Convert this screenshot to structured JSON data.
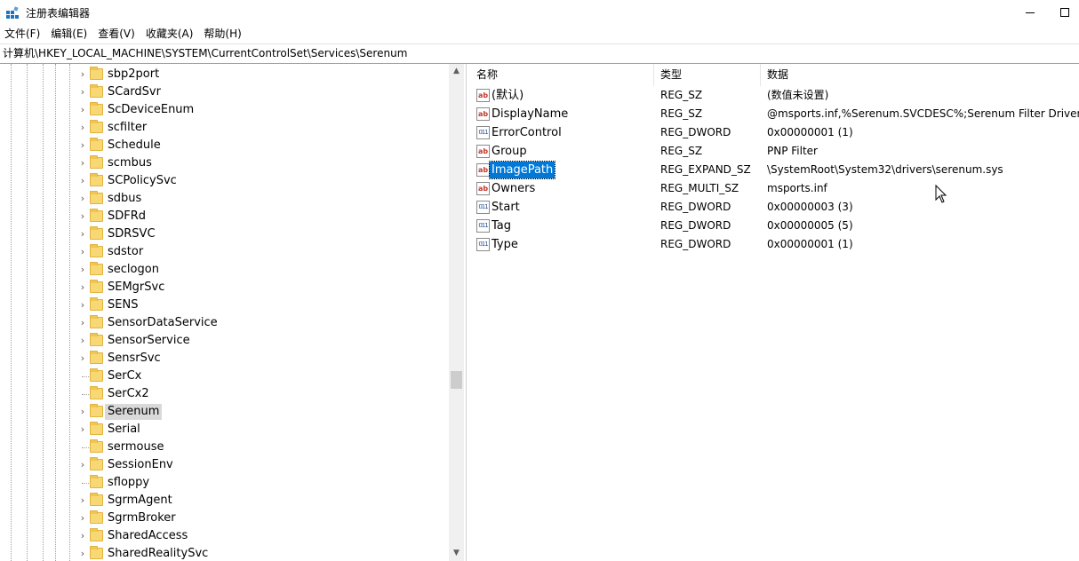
{
  "window": {
    "title": "注册表编辑器",
    "minimize_icon": "minimize-icon",
    "maximize_icon": "maximize-icon"
  },
  "menu": [
    "文件(F)",
    "编辑(E)",
    "查看(V)",
    "收藏夹(A)",
    "帮助(H)"
  ],
  "address": "计算机\\HKEY_LOCAL_MACHINE\\SYSTEM\\CurrentControlSet\\Services\\Serenum",
  "tree": {
    "items": [
      {
        "label": "sbp2port",
        "expandable": true
      },
      {
        "label": "SCardSvr",
        "expandable": true
      },
      {
        "label": "ScDeviceEnum",
        "expandable": true
      },
      {
        "label": "scfilter",
        "expandable": true
      },
      {
        "label": "Schedule",
        "expandable": true
      },
      {
        "label": "scmbus",
        "expandable": true
      },
      {
        "label": "SCPolicySvc",
        "expandable": true
      },
      {
        "label": "sdbus",
        "expandable": true
      },
      {
        "label": "SDFRd",
        "expandable": true
      },
      {
        "label": "SDRSVC",
        "expandable": true
      },
      {
        "label": "sdstor",
        "expandable": true
      },
      {
        "label": "seclogon",
        "expandable": true
      },
      {
        "label": "SEMgrSvc",
        "expandable": true
      },
      {
        "label": "SENS",
        "expandable": true
      },
      {
        "label": "SensorDataService",
        "expandable": true
      },
      {
        "label": "SensorService",
        "expandable": true
      },
      {
        "label": "SensrSvc",
        "expandable": true
      },
      {
        "label": "SerCx",
        "expandable": false
      },
      {
        "label": "SerCx2",
        "expandable": false
      },
      {
        "label": "Serenum",
        "expandable": true,
        "selected": true
      },
      {
        "label": "Serial",
        "expandable": true
      },
      {
        "label": "sermouse",
        "expandable": false
      },
      {
        "label": "SessionEnv",
        "expandable": true
      },
      {
        "label": "sfloppy",
        "expandable": false
      },
      {
        "label": "SgrmAgent",
        "expandable": true
      },
      {
        "label": "SgrmBroker",
        "expandable": true
      },
      {
        "label": "SharedAccess",
        "expandable": true
      },
      {
        "label": "SharedRealitySvc",
        "expandable": true
      }
    ]
  },
  "values": {
    "headers": {
      "name": "名称",
      "type": "类型",
      "data": "数据"
    },
    "rows": [
      {
        "icon": "ab",
        "kind": "string-value-icon",
        "name": "(默认)",
        "type": "REG_SZ",
        "data": "(数值未设置)"
      },
      {
        "icon": "ab",
        "kind": "string-value-icon",
        "name": "DisplayName",
        "type": "REG_SZ",
        "data": "@msports.inf,%Serenum.SVCDESC%;Serenum Filter Driver"
      },
      {
        "icon": "011",
        "kind": "binary-value-icon",
        "name": "ErrorControl",
        "type": "REG_DWORD",
        "data": "0x00000001 (1)"
      },
      {
        "icon": "ab",
        "kind": "string-value-icon",
        "name": "Group",
        "type": "REG_SZ",
        "data": "PNP Filter"
      },
      {
        "icon": "ab",
        "kind": "string-value-icon",
        "name": "ImagePath",
        "type": "REG_EXPAND_SZ",
        "data": "\\SystemRoot\\System32\\drivers\\serenum.sys",
        "selected": true
      },
      {
        "icon": "ab",
        "kind": "string-value-icon",
        "name": "Owners",
        "type": "REG_MULTI_SZ",
        "data": "msports.inf"
      },
      {
        "icon": "011",
        "kind": "binary-value-icon",
        "name": "Start",
        "type": "REG_DWORD",
        "data": "0x00000003 (3)"
      },
      {
        "icon": "011",
        "kind": "binary-value-icon",
        "name": "Tag",
        "type": "REG_DWORD",
        "data": "0x00000005 (5)"
      },
      {
        "icon": "011",
        "kind": "binary-value-icon",
        "name": "Type",
        "type": "REG_DWORD",
        "data": "0x00000001 (1)"
      }
    ]
  },
  "colors": {
    "selection": "#0078d7",
    "tree_selection": "#d9d9d9",
    "folder": "#f8d775"
  }
}
